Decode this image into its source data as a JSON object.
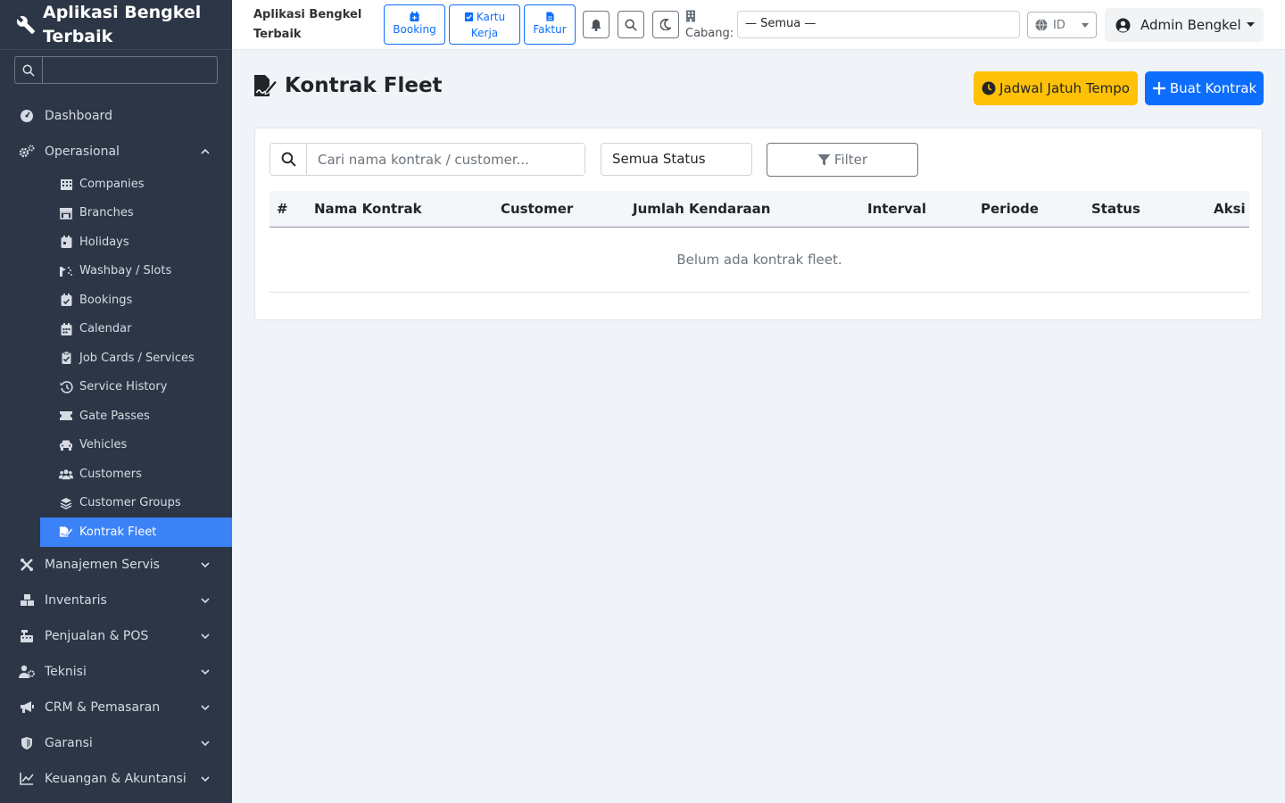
{
  "app": {
    "title": "Aplikasi Bengkel Terbaik"
  },
  "sidebar": {
    "brand": "Aplikasi Bengkel Terbaik",
    "search_placeholder": "",
    "items": [
      {
        "label": "Dashboard",
        "icon": "gauge-icon"
      },
      {
        "label": "Operasional",
        "icon": "cogs-icon",
        "expanded": true
      },
      {
        "label": "Manajemen Servis",
        "icon": "tools-icon"
      },
      {
        "label": "Inventaris",
        "icon": "boxes-icon"
      },
      {
        "label": "Penjualan & POS",
        "icon": "cash-register-icon"
      },
      {
        "label": "Teknisi",
        "icon": "user-gear-icon"
      },
      {
        "label": "CRM & Pemasaran",
        "icon": "bullhorn-icon"
      },
      {
        "label": "Garansi",
        "icon": "shield-icon"
      },
      {
        "label": "Keuangan & Akuntansi",
        "icon": "chart-line-icon"
      }
    ],
    "sub_items": [
      {
        "label": "Companies",
        "icon": "building-icon"
      },
      {
        "label": "Branches",
        "icon": "store-icon"
      },
      {
        "label": "Holidays",
        "icon": "calendar-day-icon"
      },
      {
        "label": "Washbay / Slots",
        "icon": "spray-icon"
      },
      {
        "label": "Bookings",
        "icon": "calendar-check-icon"
      },
      {
        "label": "Calendar",
        "icon": "calendar-icon"
      },
      {
        "label": "Job Cards / Services",
        "icon": "clipboard-check-icon"
      },
      {
        "label": "Service History",
        "icon": "history-icon"
      },
      {
        "label": "Gate Passes",
        "icon": "ticket-icon"
      },
      {
        "label": "Vehicles",
        "icon": "car-icon"
      },
      {
        "label": "Customers",
        "icon": "users-icon"
      },
      {
        "label": "Customer Groups",
        "icon": "layer-group-icon"
      },
      {
        "label": "Kontrak Fleet",
        "icon": "file-signature-icon",
        "active": true
      }
    ]
  },
  "topbar": {
    "title_line1": "Aplikasi Bengkel",
    "title_line2": "Terbaik",
    "quick": [
      {
        "line1": "",
        "line2": "Booking",
        "icon": "calendar-plus-icon"
      },
      {
        "line1": "Kartu",
        "line2": "Kerja",
        "icon": "clipboard-check-icon"
      },
      {
        "line1": "",
        "line2": "Faktur",
        "icon": "file-invoice-icon"
      }
    ],
    "cabang_label": "Cabang:",
    "branch_value": "— Semua —",
    "lang_value": "ID",
    "user_name": "Admin Bengkel"
  },
  "page": {
    "title": "Kontrak Fleet",
    "btn_due": "Jadwal Jatuh Tempo",
    "btn_create": "Buat Kontrak",
    "search_placeholder": "Cari nama kontrak / customer...",
    "status_value": "Semua Status",
    "filter_label": "Filter",
    "columns": [
      "#",
      "Nama Kontrak",
      "Customer",
      "Jumlah Kendaraan",
      "Interval",
      "Periode",
      "Status",
      "Aksi"
    ],
    "empty_text": "Belum ada kontrak fleet."
  },
  "colors": {
    "sidebar_bg": "#2c3646",
    "active": "#3b82f6",
    "primary": "#0d6efd",
    "warning": "#ffc107",
    "page_bg": "#f0f3f8"
  }
}
